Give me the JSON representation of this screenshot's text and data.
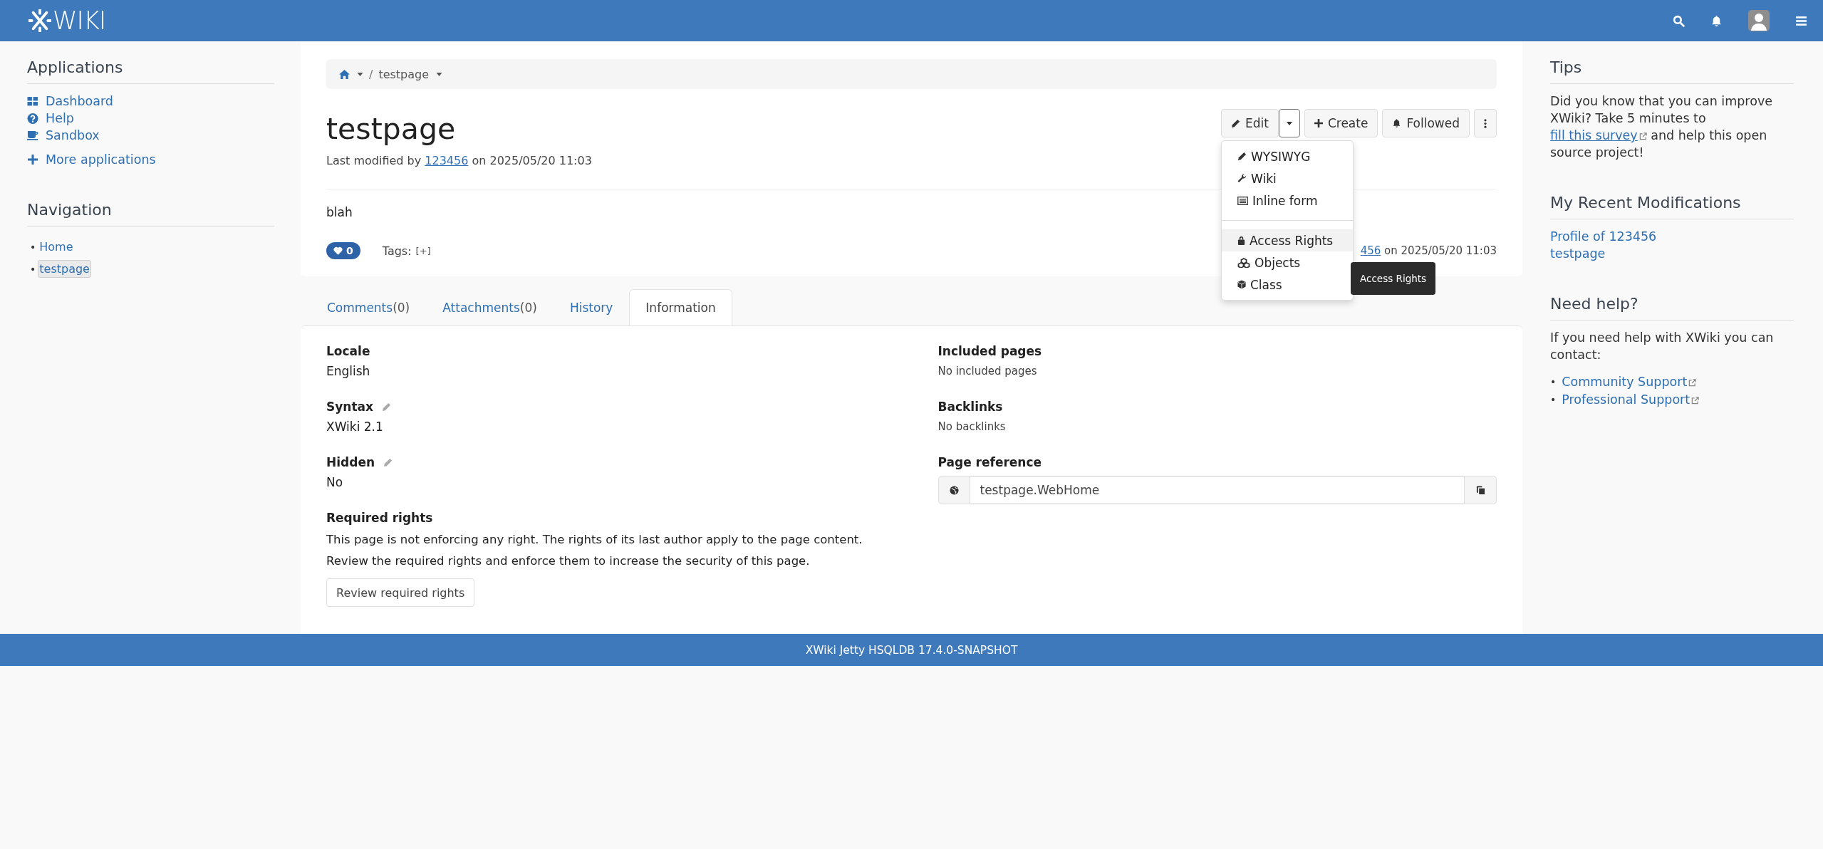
{
  "header": {
    "logo_text": "WIKI"
  },
  "left_sidebar": {
    "applications": {
      "title": "Applications",
      "items": [
        {
          "label": "Dashboard",
          "kind": "dashboard"
        },
        {
          "label": "Help",
          "kind": "help"
        },
        {
          "label": "Sandbox",
          "kind": "sandbox"
        }
      ],
      "more": "More applications"
    },
    "navigation": {
      "title": "Navigation",
      "items": [
        {
          "marker": "•",
          "label": "Home",
          "selected": false
        },
        {
          "marker": "•",
          "label": "testpage",
          "selected": true
        }
      ]
    }
  },
  "breadcrumb": {
    "separator": "/",
    "items": [
      "testpage"
    ]
  },
  "page": {
    "title": "testpage",
    "last_modified": {
      "prefix": "Last modified by",
      "author": "123456",
      "suffix": "on 2025/05/20 11:03"
    },
    "actions": [
      {
        "label": "Edit",
        "kind": "pencil"
      },
      {
        "label": "Create",
        "kind": "plus"
      },
      {
        "label": "Followed",
        "kind": "bell"
      }
    ],
    "edit_menu": {
      "groups": [
        [
          {
            "label": "WYSIWYG",
            "kind": "pencil",
            "highlighted": false
          },
          {
            "label": "Wiki",
            "kind": "wrench",
            "highlighted": false
          },
          {
            "label": "Inline form",
            "kind": "form",
            "highlighted": false
          }
        ],
        [
          {
            "label": "Access Rights",
            "kind": "lock",
            "highlighted": true
          },
          {
            "label": "Objects",
            "kind": "cubes",
            "highlighted": false
          },
          {
            "label": "Class",
            "kind": "cube",
            "highlighted": false
          }
        ]
      ],
      "tooltip": "Access Rights"
    },
    "content": "blah",
    "likes": "0",
    "tags_label": "Tags:",
    "tags_add": "[+]",
    "footer_author": "456",
    "footer_date": "on 2025/05/20 11:03"
  },
  "tabs": [
    {
      "label": "Comments",
      "count": "(0)",
      "selected": false
    },
    {
      "label": "Attachments",
      "count": "(0)",
      "selected": false
    },
    {
      "label": "History",
      "selected": false
    },
    {
      "label": "Information",
      "selected": true
    }
  ],
  "information": {
    "left": [
      {
        "label": "Locale",
        "value": "English",
        "editable": false
      },
      {
        "label": "Syntax",
        "value": "XWiki 2.1",
        "editable": true
      },
      {
        "label": "Hidden",
        "value": "No",
        "editable": true
      }
    ],
    "required_rights": {
      "label": "Required rights",
      "texts": [
        "This page is not enforcing any right. The rights of its last author apply to the page content.",
        "Review the required rights and enforce them to increase the security of this page."
      ],
      "button": "Review required rights"
    },
    "right": [
      {
        "label": "Included pages",
        "value": "No included pages"
      },
      {
        "label": "Backlinks",
        "value": "No backlinks"
      }
    ],
    "page_reference": {
      "label": "Page reference",
      "value": "testpage.WebHome"
    }
  },
  "right_sidebar": {
    "tips": {
      "title": "Tips",
      "before": "Did you know that you can improve XWiki? Take 5 minutes to",
      "link": "fill this survey",
      "after": "and help this open source project!"
    },
    "recent": {
      "title": "My Recent Modifications",
      "items": [
        "Profile of 123456",
        "testpage"
      ]
    },
    "help": {
      "title": "Need help?",
      "text": "If you need help with XWiki you can contact:",
      "links": [
        {
          "marker": "•",
          "label": "Community Support"
        },
        {
          "marker": "•",
          "label": "Professional Support"
        }
      ]
    }
  },
  "footer": {
    "text": "XWiki Jetty HSQLDB 17.4.0-SNAPSHOT"
  }
}
